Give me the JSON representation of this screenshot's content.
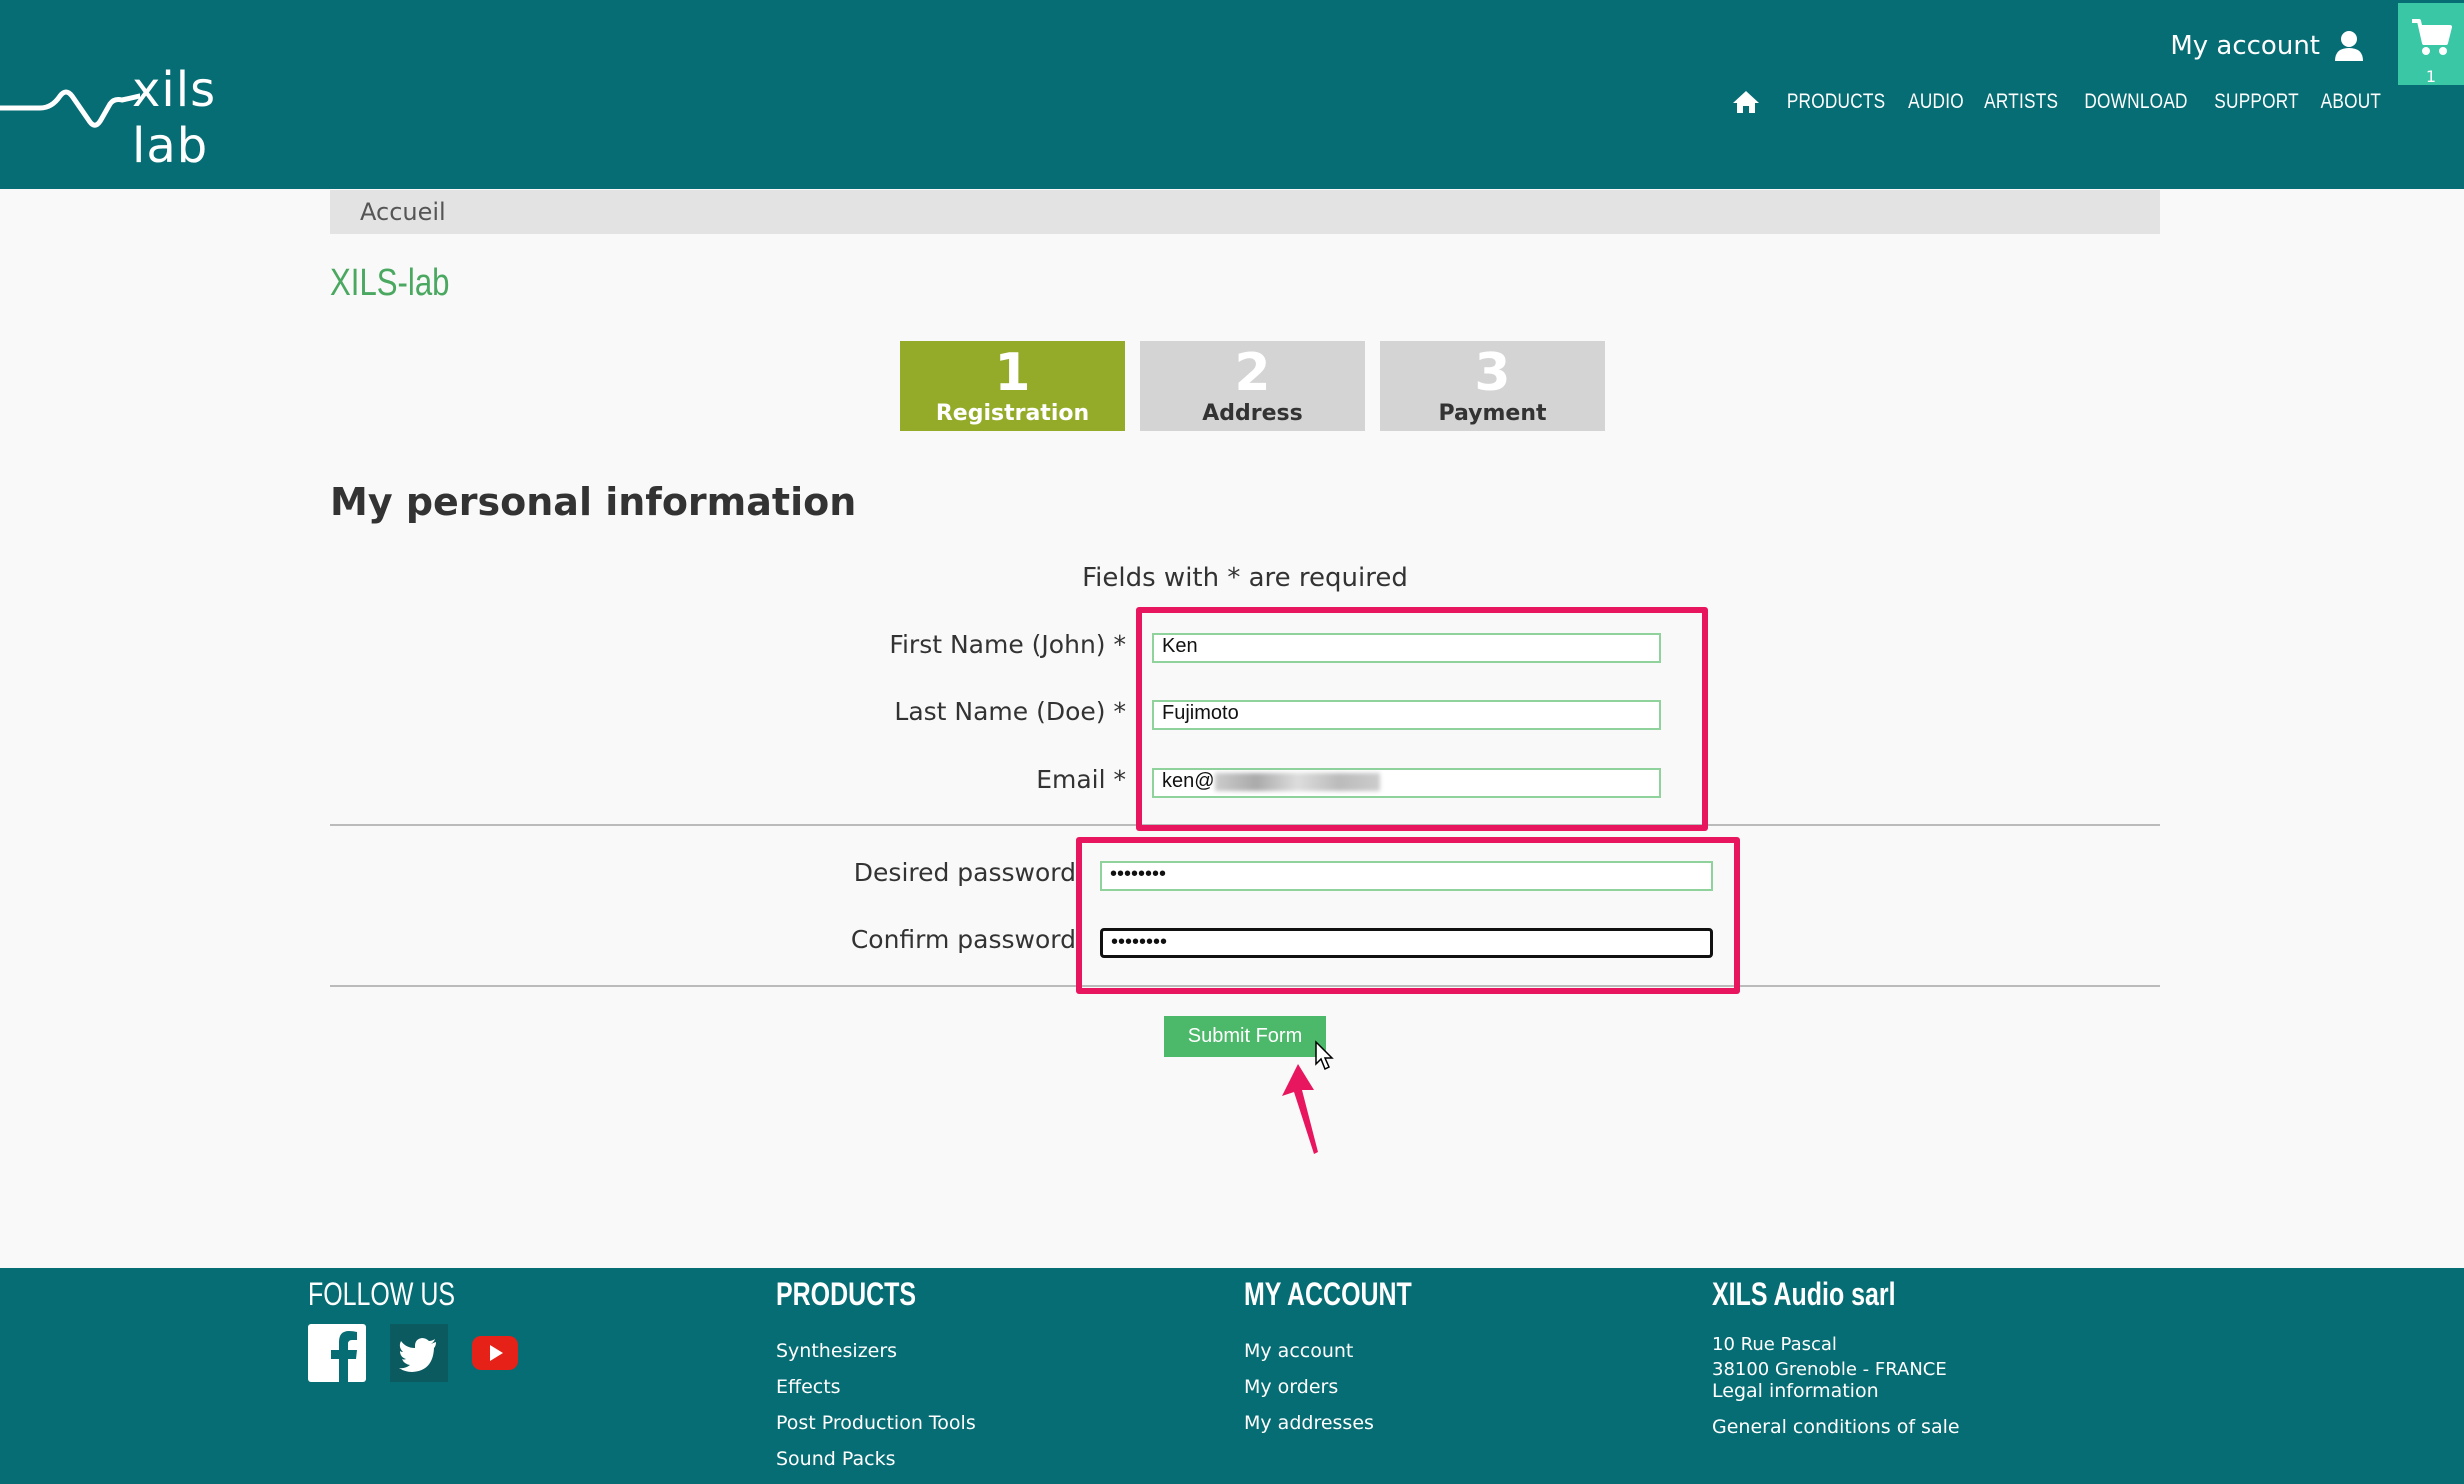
{
  "header": {
    "logo_text": "xils lab",
    "my_account": "My account",
    "cart_count": "1",
    "nav": [
      "PRODUCTS",
      "AUDIO",
      "ARTISTS",
      "DOWNLOAD",
      "SUPPORT",
      "ABOUT"
    ]
  },
  "breadcrumb": "Accueil",
  "site_title": "XILS-lab",
  "steps": [
    {
      "number": "1",
      "label": "Registration",
      "active": true
    },
    {
      "number": "2",
      "label": "Address",
      "active": false
    },
    {
      "number": "3",
      "label": "Payment",
      "active": false
    }
  ],
  "form": {
    "heading": "My personal information",
    "required_note": "Fields with * are required",
    "first_name_label": "First Name (John) *",
    "first_name_value": "Ken",
    "last_name_label": "Last Name (Doe) *",
    "last_name_value": "Fujimoto",
    "email_label": "Email *",
    "email_value": "ken@",
    "password_label": "Desired password",
    "password_value": "••••••••",
    "confirm_label": "Confirm password",
    "confirm_value": "••••••••",
    "submit_label": "Submit Form"
  },
  "footer": {
    "follow_us": "FOLLOW US",
    "products_head": "PRODUCTS",
    "products": [
      "Synthesizers",
      "Effects",
      "Post Production Tools",
      "Sound Packs"
    ],
    "account_head": "MY ACCOUNT",
    "account": [
      "My account",
      "My orders",
      "My addresses"
    ],
    "company_head": "XILS Audio sarl",
    "address_line1": "10 Rue Pascal",
    "address_line2": "38100 Grenoble - FRANCE",
    "company_links": [
      "Legal information",
      "General conditions of sale"
    ]
  },
  "colors": {
    "header_bg": "#066d74",
    "cart_bg": "#39c7a5",
    "step_active": "#94ab2a",
    "step_inactive": "#d4d4d4",
    "submit_bg": "#4cb96a",
    "highlight": "#e8165f",
    "title_green": "#4aa860"
  },
  "icons": [
    "home-icon",
    "user-icon",
    "cart-icon",
    "facebook-icon",
    "twitter-icon",
    "youtube-icon",
    "cursor-icon",
    "annotation-arrow-icon"
  ]
}
